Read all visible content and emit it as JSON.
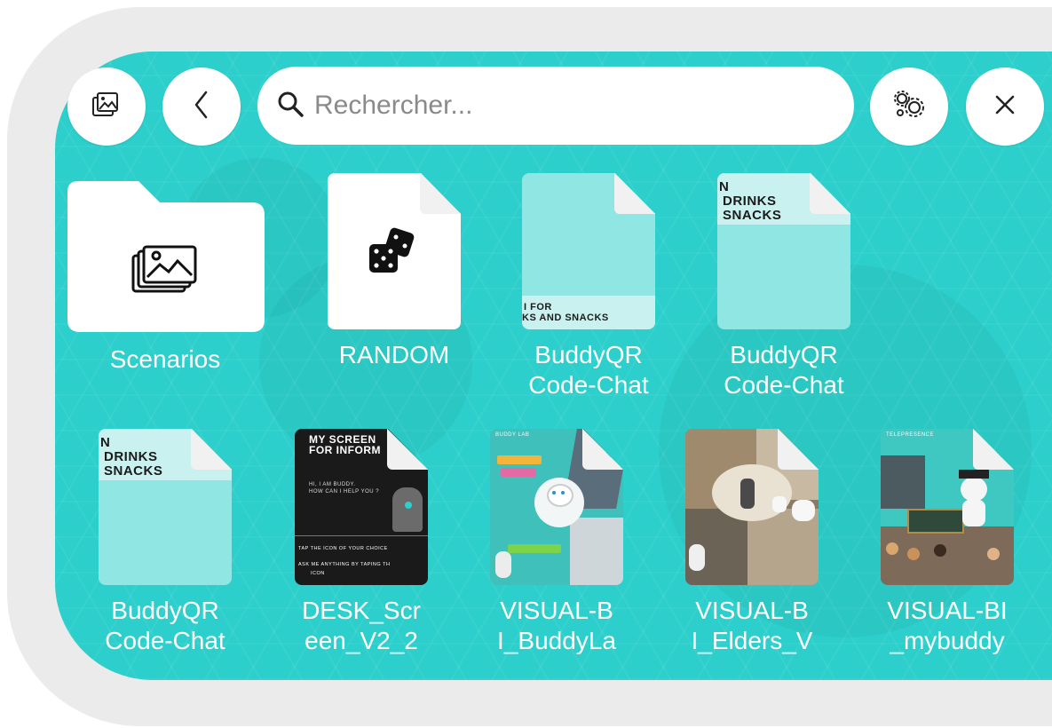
{
  "toolbar": {
    "search_placeholder": "Rechercher...",
    "gallery_icon": "gallery-icon",
    "back_icon": "chevron-left-icon",
    "settings_icon": "gears-icon",
    "close_icon": "close-icon",
    "close_glyph": "✕",
    "back_glyph": "‹"
  },
  "grid": {
    "items": [
      {
        "label": "Scenarios",
        "type": "folder",
        "icon": "images-icon"
      },
      {
        "label": "RANDOM",
        "type": "file",
        "icon": "dice-icon"
      },
      {
        "label": "BuddyQR Code-Chat",
        "type": "file-thumbnail",
        "thumb_text_bottom": [
          "I FOR",
          "KS AND SNACKS"
        ]
      },
      {
        "label": "BuddyQR Code-Chat",
        "type": "file-thumbnail",
        "thumb_text_top": [
          "N",
          "DRINKS",
          "SNACKS"
        ]
      },
      {
        "label": "BuddyQR Code-Chat",
        "type": "file-thumbnail",
        "thumb_text_top": [
          "N",
          "DRINKS",
          "SNACKS"
        ]
      },
      {
        "label": "DESK_Scr een_V2_2",
        "type": "file-thumbnail",
        "thumb_text": [
          "MY SCREEN",
          "FOR INFORM",
          "HI, I AM BUDDY.",
          "HOW CAN I HELP YOU ?",
          "TAP THE ICON OF YOUR CHOICE",
          "ASK ME ANYTHING BY TAPING TH",
          "ICON"
        ]
      },
      {
        "label": "VISUAL-B I_BuddyLa",
        "type": "file-thumbnail",
        "thumb_text": [
          "BUDDY LAB"
        ]
      },
      {
        "label": "VISUAL-B I_Elders_V",
        "type": "file-thumbnail"
      },
      {
        "label": "VISUAL-BI _mybuddy",
        "type": "file-thumbnail",
        "thumb_text": [
          "TELEPRESENCE"
        ]
      }
    ]
  },
  "colors": {
    "panel_bg": "#2ccfcb",
    "frame_bg": "#ebebeb",
    "thumb_light": "#8fe6e2",
    "text": "#ffffff"
  }
}
